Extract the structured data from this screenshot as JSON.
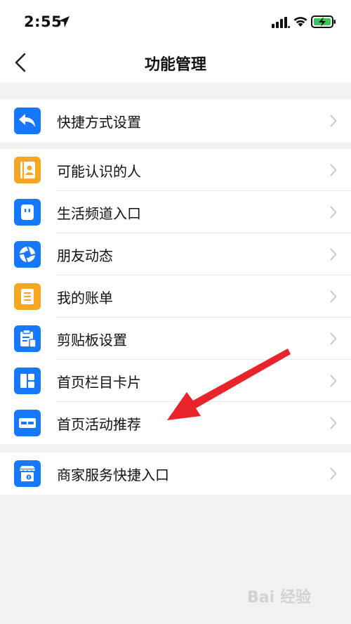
{
  "status_bar": {
    "time": "2:55",
    "icons": [
      "location-arrow-icon",
      "signal-icon",
      "wifi-icon",
      "battery-charging-icon"
    ]
  },
  "nav": {
    "title": "功能管理",
    "back_icon": "chevron-left-icon"
  },
  "groups": [
    {
      "items": [
        {
          "label": "快捷方式设置",
          "icon": "shortcut-reply-icon",
          "color": "#1677ff"
        }
      ]
    },
    {
      "items": [
        {
          "label": "可能认识的人",
          "icon": "contact-card-icon",
          "color": "#f5a623"
        },
        {
          "label": "生活频道入口",
          "icon": "life-channel-icon",
          "color": "#1677ff"
        },
        {
          "label": "朋友动态",
          "icon": "shutter-icon",
          "color": "#1677ff"
        },
        {
          "label": "我的账单",
          "icon": "bill-icon",
          "color": "#f5a623"
        },
        {
          "label": "剪贴板设置",
          "icon": "clipboard-icon",
          "color": "#1677ff"
        },
        {
          "label": "首页栏目卡片",
          "icon": "cards-icon",
          "color": "#1677ff"
        },
        {
          "label": "首页活动推荐",
          "icon": "promo-card-icon",
          "color": "#1677ff"
        }
      ]
    },
    {
      "items": [
        {
          "label": "商家服务快捷入口",
          "icon": "merchant-store-icon",
          "color": "#1677ff"
        }
      ]
    }
  ],
  "annotation": {
    "type": "red-arrow",
    "color": "#e8232a",
    "points_to": "首页活动推荐"
  },
  "watermark": {
    "text": "Bai 经验"
  }
}
